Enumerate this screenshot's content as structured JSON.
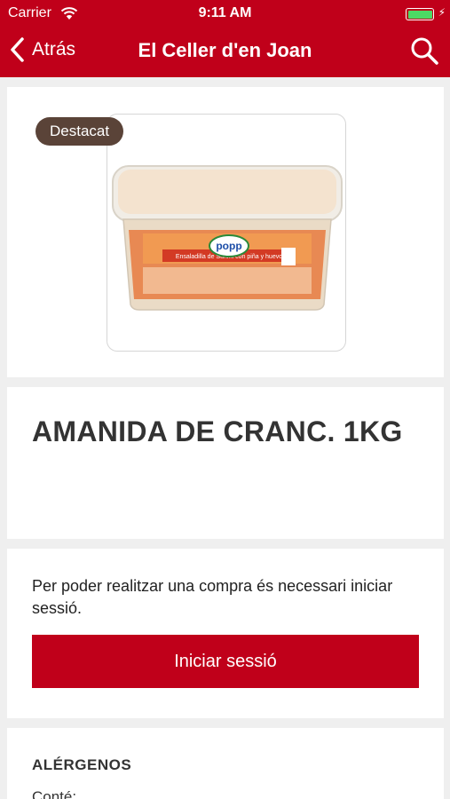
{
  "status": {
    "carrier": "Carrier",
    "time": "9:11 AM",
    "battery_level": 1.0
  },
  "nav": {
    "back_label": "Atrás",
    "title": "El Celler d'en Joan"
  },
  "product": {
    "badge": "Destacat",
    "image_brand": "popp",
    "image_caption": "Ensaladilla de Surimi con piña y huevo",
    "title": "AMANIDA DE CRANC. 1KG",
    "image_count": 1,
    "current_image": 1
  },
  "login": {
    "message": "Per poder realitzar una compra és necessari iniciar sessió.",
    "button_label": "Iniciar sessió"
  },
  "allergens": {
    "heading": "ALÉRGENOS",
    "contains_label": "Conté:"
  },
  "colors": {
    "brand": "#c0001a",
    "badge": "#5a4338",
    "page_dot": "#1a7cf5"
  }
}
